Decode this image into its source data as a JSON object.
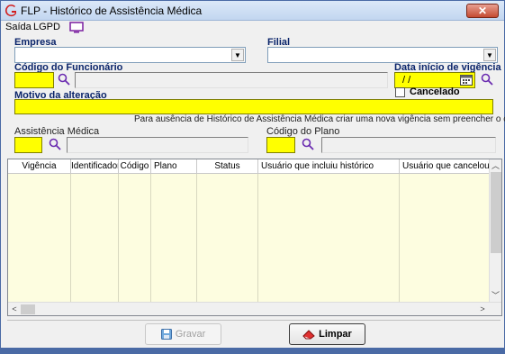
{
  "window": {
    "title": "FLP - Histórico de Assistência Médica",
    "close_label": "✕"
  },
  "menu": {
    "saida": "Saída",
    "lgpd": "LGPD"
  },
  "form": {
    "empresa_label": "Empresa",
    "filial_label": "Filial",
    "codigo_funcionario_label": "Código do Funcionário",
    "data_inicio_label": "Data início de vigência",
    "data_inicio_value": "/ /",
    "cancelado_label": "Cancelado",
    "motivo_label": "Motivo da alteração",
    "hint": "Para ausência de Histórico de Assistência Médica criar uma nova vigência sem preencher o código",
    "assistencia_label": "Assistência Médica",
    "codigo_plano_label": "Código do Plano"
  },
  "grid": {
    "columns": [
      "Vigência",
      "Identificador",
      "Código",
      "Plano",
      "Status",
      "Usuário que incluiu histórico",
      "Usuário que cancelou hi"
    ],
    "rows": []
  },
  "buttons": {
    "gravar": "Gravar",
    "limpar": "Limpar"
  },
  "colors": {
    "required_field": "#ffff00",
    "grid_background": "#fdfde0",
    "label_bold": "#0a246a"
  }
}
